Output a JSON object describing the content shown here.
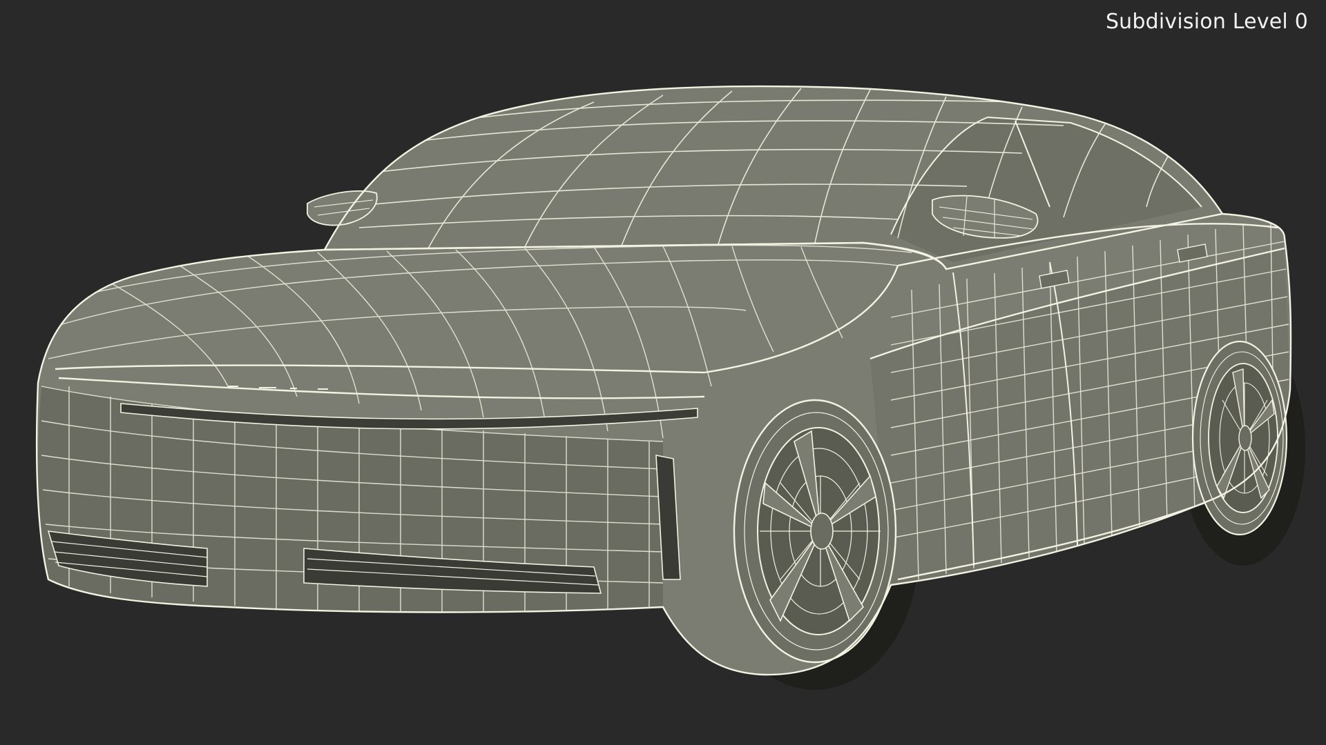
{
  "viewport": {
    "label": "Subdivision Level 0",
    "background_color": "#292929",
    "model": {
      "subject": "sedan car",
      "render_style": "wireframe over solid shaded mesh",
      "surface_color": "#7c7d72",
      "wire_color": "#f3f3e4",
      "shadow_color": "#545549"
    }
  }
}
